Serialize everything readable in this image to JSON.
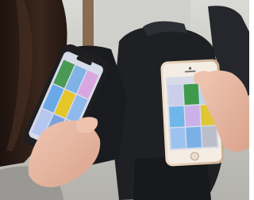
{
  "scene": {
    "description_colors": {
      "floor": "#b9b8b2",
      "floor_light": "#d6d5d0",
      "hair": "#2a1a14",
      "skin": "#e9b9a4",
      "sleeve": "#9a9895",
      "backpack": "#1e2024",
      "phone_left_case": "#1f1f22",
      "phone_right_frame": "#d8c3a8",
      "screen_bg": "#d7dbe8"
    },
    "left_phone_tiles": [
      {
        "color": "#4a9a55"
      },
      {
        "color": "#7fb2e5"
      },
      {
        "color": "#d9a7e0"
      },
      {
        "color": "#6aa8e8"
      },
      {
        "color": "#e4c52a"
      },
      {
        "color": "#8fb9ea"
      },
      {
        "color": "#b6c7ef"
      },
      {
        "color": "#7aa3e0"
      },
      {
        "color": "#a4b7ea"
      }
    ],
    "right_phone_tiles": [
      {
        "color": "#c9cfe8"
      },
      {
        "color": "#3f9a4c"
      },
      {
        "color": "#b8d3f2"
      },
      {
        "color": "#6fb7e8"
      },
      {
        "color": "#cbb0ea"
      },
      {
        "color": "#e0c630"
      },
      {
        "color": "#9cc3ef"
      },
      {
        "color": "#7bb0e6"
      },
      {
        "color": "#b9bec8"
      }
    ]
  }
}
